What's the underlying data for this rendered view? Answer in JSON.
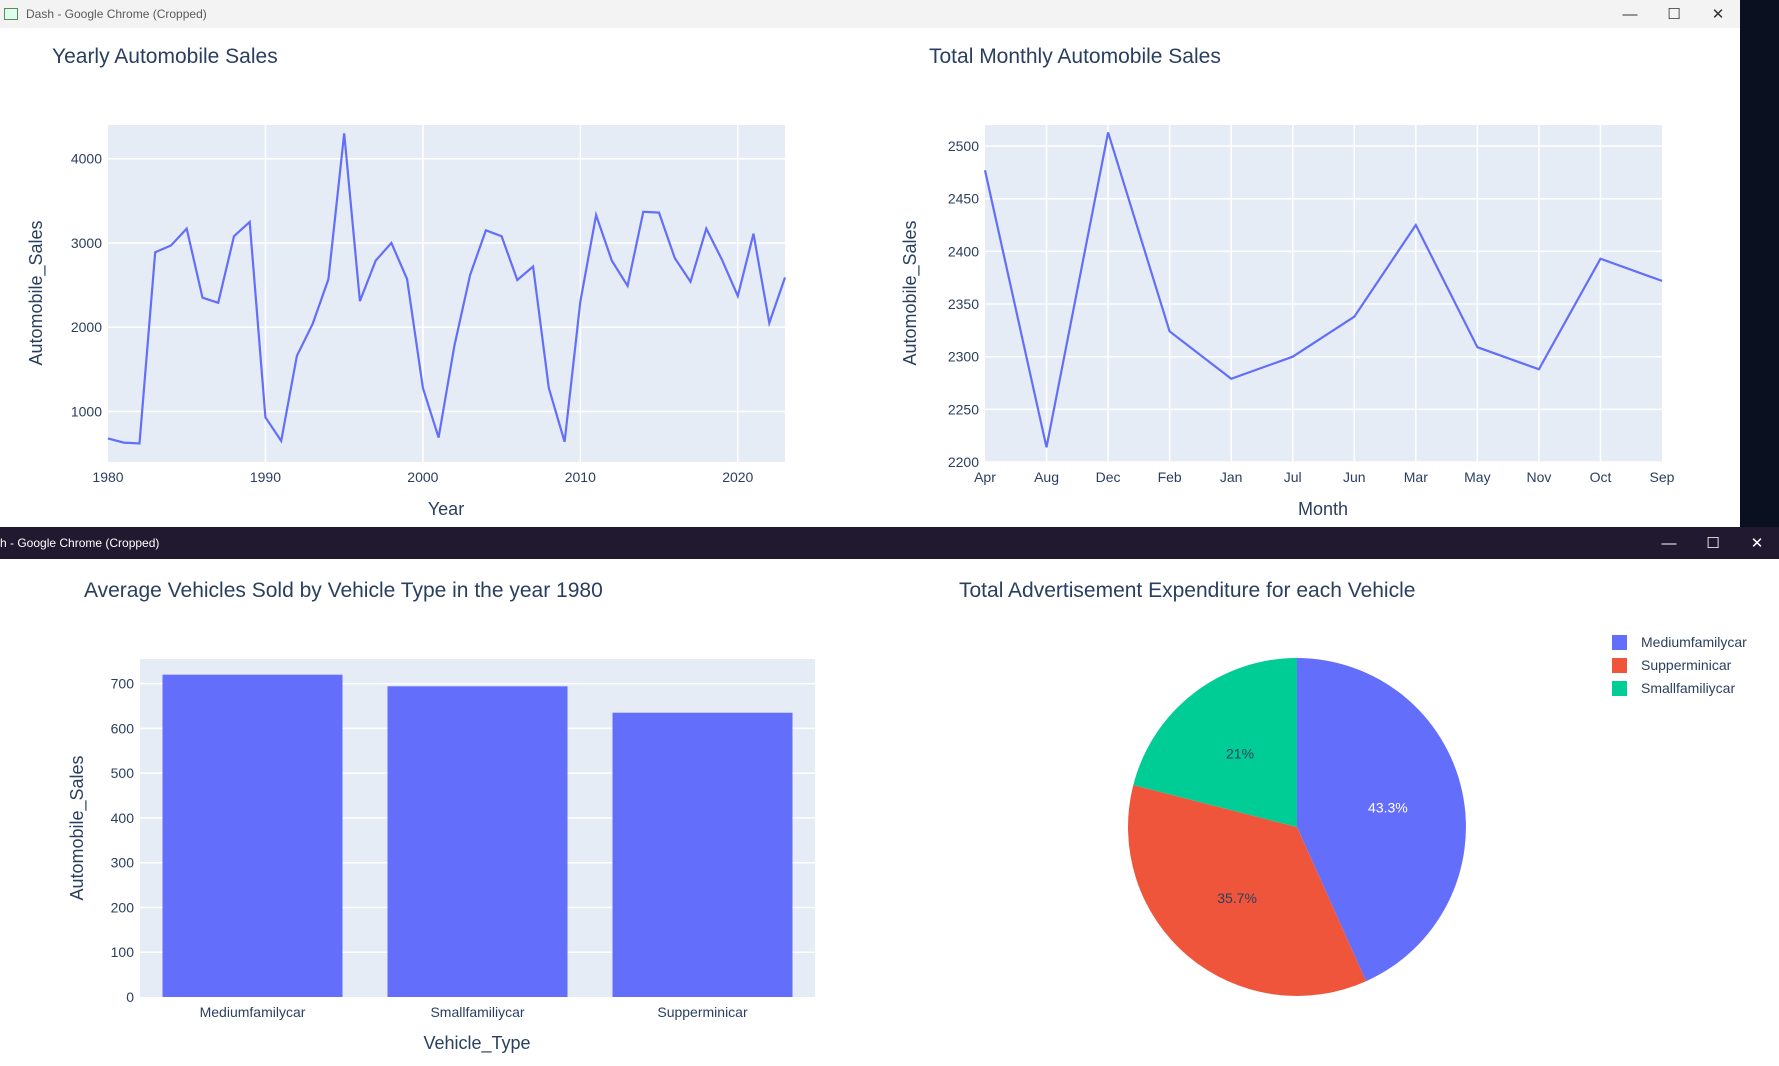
{
  "window1": {
    "title": "Dash - Google Chrome (Cropped)"
  },
  "window2": {
    "title": "h - Google Chrome (Cropped)"
  },
  "icons": {
    "minimize": "minimize-icon",
    "maximize": "maximize-icon",
    "close": "close-icon"
  },
  "colors": {
    "plot_bg": "#e5ecf6",
    "series": "#636efa",
    "pie": [
      "#636efa",
      "#ef553b",
      "#00cc96"
    ],
    "text": "#2a3f5f"
  },
  "chart_data": [
    {
      "type": "line",
      "title": "Yearly Automobile Sales",
      "xlabel": "Year",
      "ylabel": "Automobile_Sales",
      "xlim": [
        1980,
        2023
      ],
      "ylim": [
        400,
        4400
      ],
      "xticks": [
        "1980",
        "1990",
        "2000",
        "2010",
        "2020"
      ],
      "yticks": [
        "1000",
        "2000",
        "3000",
        "4000"
      ],
      "grid": true,
      "x": [
        1980,
        1981,
        1982,
        1983,
        1984,
        1985,
        1986,
        1987,
        1988,
        1989,
        1990,
        1991,
        1992,
        1993,
        1994,
        1995,
        1996,
        1997,
        1998,
        1999,
        2000,
        2001,
        2002,
        2003,
        2004,
        2005,
        2006,
        2007,
        2008,
        2009,
        2010,
        2011,
        2012,
        2013,
        2014,
        2015,
        2016,
        2017,
        2018,
        2019,
        2020,
        2021,
        2022,
        2023
      ],
      "values": [
        680,
        630,
        620,
        2890,
        2970,
        3170,
        2350,
        2290,
        3080,
        3250,
        930,
        650,
        1660,
        2040,
        2570,
        4300,
        2310,
        2790,
        3000,
        2570,
        1280,
        690,
        1780,
        2620,
        3150,
        3080,
        2560,
        2720,
        1280,
        640,
        2300,
        3330,
        2790,
        2490,
        3370,
        3360,
        2820,
        2540,
        3170,
        2800,
        2370,
        3110,
        2050,
        2590
      ]
    },
    {
      "type": "line",
      "title": "Total Monthly Automobile Sales",
      "xlabel": "Month",
      "ylabel": "Automobile_Sales",
      "ylim": [
        2200,
        2520
      ],
      "yticks": [
        "2200",
        "2250",
        "2300",
        "2350",
        "2400",
        "2450",
        "2500"
      ],
      "grid": true,
      "categories": [
        "Apr",
        "Aug",
        "Dec",
        "Feb",
        "Jan",
        "Jul",
        "Jun",
        "Mar",
        "May",
        "Nov",
        "Oct",
        "Sep"
      ],
      "values": [
        2477,
        2214,
        2513,
        2324,
        2279,
        2300,
        2338,
        2425,
        2309,
        2288,
        2393,
        2372
      ]
    },
    {
      "type": "bar",
      "title": "Average Vehicles Sold by Vehicle Type in the year 1980",
      "xlabel": "Vehicle_Type",
      "ylabel": "Automobile_Sales",
      "ylim": [
        0,
        755
      ],
      "yticks": [
        "0",
        "100",
        "200",
        "300",
        "400",
        "500",
        "600",
        "700"
      ],
      "grid": true,
      "categories": [
        "Mediumfamilycar",
        "Smallfamiliycar",
        "Supperminicar"
      ],
      "values": [
        720,
        694,
        635
      ]
    },
    {
      "type": "pie",
      "title": "Total Advertisement Expenditure for each Vehicle",
      "legend_position": "top-right",
      "categories": [
        "Mediumfamilycar",
        "Supperminicar",
        "Smallfamiliycar"
      ],
      "values": [
        43.3,
        35.7,
        21
      ],
      "labels": [
        "43.3%",
        "35.7%",
        "21%"
      ]
    }
  ]
}
